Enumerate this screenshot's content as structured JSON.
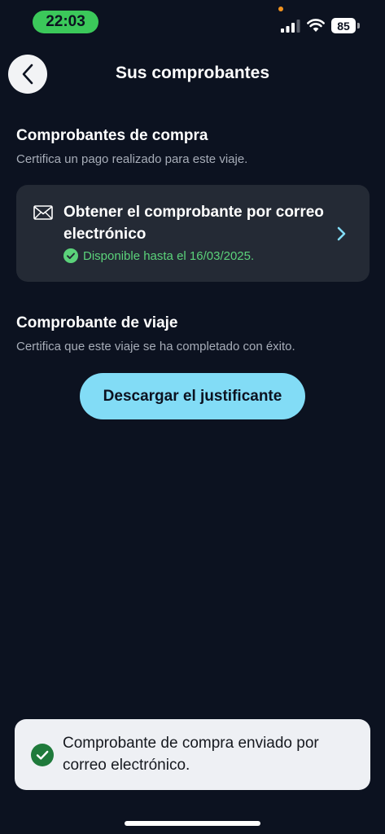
{
  "status_bar": {
    "time": "22:03",
    "battery": "85",
    "colors": {
      "time_pill": "#3bc85a",
      "privacy_dot": "#f0921e"
    },
    "icons": [
      "signal-icon",
      "wifi-icon",
      "battery-icon"
    ]
  },
  "header": {
    "title": "Sus comprobantes",
    "back_icon": "chevron-left-icon"
  },
  "purchase_section": {
    "title": "Comprobantes de compra",
    "subtitle": "Certifica un pago realizado para este viaje.",
    "card": {
      "icon": "mail-icon",
      "title": "Obtener el comprobante por correo electrónico",
      "availability": "Disponible hasta el 16/03/2025.",
      "status_icon": "check-circle-icon",
      "chevron_icon": "chevron-right-icon"
    }
  },
  "trip_section": {
    "title": "Comprobante de viaje",
    "subtitle": "Certifica que este viaje se ha completado con éxito.",
    "button_label": "Descargar el justificante"
  },
  "toast": {
    "icon": "check-circle-icon",
    "message": "Comprobante de compra enviado por correo electrónico."
  },
  "colors": {
    "background": "#0c1220",
    "card": "#242a35",
    "accent_button": "#82dcf6",
    "success": "#5bd27a",
    "toast_background": "#eef0f4",
    "toast_check": "#1f7a3b"
  }
}
